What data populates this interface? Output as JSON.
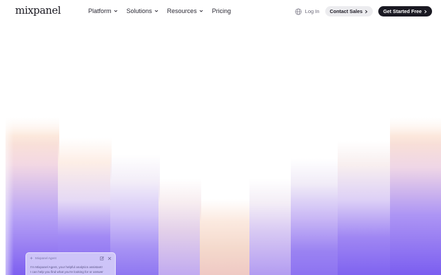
{
  "brand": {
    "logo_text": "mixpanel"
  },
  "nav": {
    "items": [
      {
        "label": "Platform",
        "has_dropdown": true,
        "icon": "chevron-down-icon"
      },
      {
        "label": "Solutions",
        "has_dropdown": true,
        "icon": "chevron-down-icon"
      },
      {
        "label": "Resources",
        "has_dropdown": true,
        "icon": "chevron-down-icon"
      },
      {
        "label": "Pricing",
        "has_dropdown": false
      }
    ],
    "language_icon": "globe-icon",
    "login_label": "Log In",
    "contact_label": "Contact Sales",
    "start_label": "Get Started Free",
    "arrow_icon": "chevron-right-icon"
  },
  "agent": {
    "title": "Mixpanel Agent",
    "body_lines": [
      "I'm Mixpanel Agent, your helpful analytics assistant!",
      "I can help you find what you're looking for or answer"
    ],
    "icons": [
      "sparkle-icon",
      "compose-icon",
      "close-icon"
    ]
  },
  "colors": {
    "text_dark": "#1c1b25",
    "button_dark": "#1a1922",
    "button_light": "#ececef",
    "gradient_purple": "#7b63f2",
    "gradient_peach": "#f7d7c4"
  }
}
